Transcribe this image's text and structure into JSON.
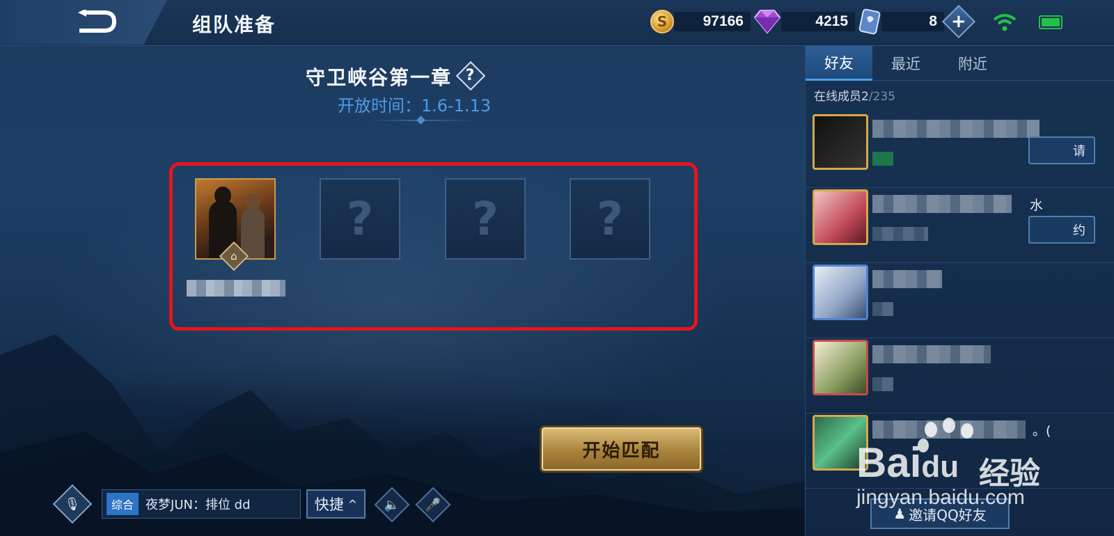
{
  "header": {
    "title": "组队准备",
    "gold": "97166",
    "diamonds": "4215",
    "coupons": "8",
    "gold_symbol": "S"
  },
  "event": {
    "title": "守卫峡谷第一章",
    "help": "?",
    "time": "开放时间：1.6-1.13"
  },
  "team": {
    "empty_slot_mark": "?",
    "leader_icon": "⌂"
  },
  "actions": {
    "start_match": "开始匹配"
  },
  "chat": {
    "channel": "综合",
    "last_message": "夜梦JUN：排位 dd",
    "quick": "快捷",
    "quick_arrow": "^"
  },
  "friends": {
    "tabs": [
      "好友",
      "最近",
      "附近"
    ],
    "online_label": "在线成员2",
    "online_total": "/235",
    "items": [
      {
        "action": "请"
      },
      {
        "action": "约",
        "tail": "水"
      },
      {},
      {},
      {
        "tail": "。("
      }
    ],
    "invite": "邀请QQ好友"
  },
  "watermark": {
    "brand": "Bai",
    "brand2": "du",
    "cn": "经验",
    "url": "jingyan.baidu.com"
  }
}
